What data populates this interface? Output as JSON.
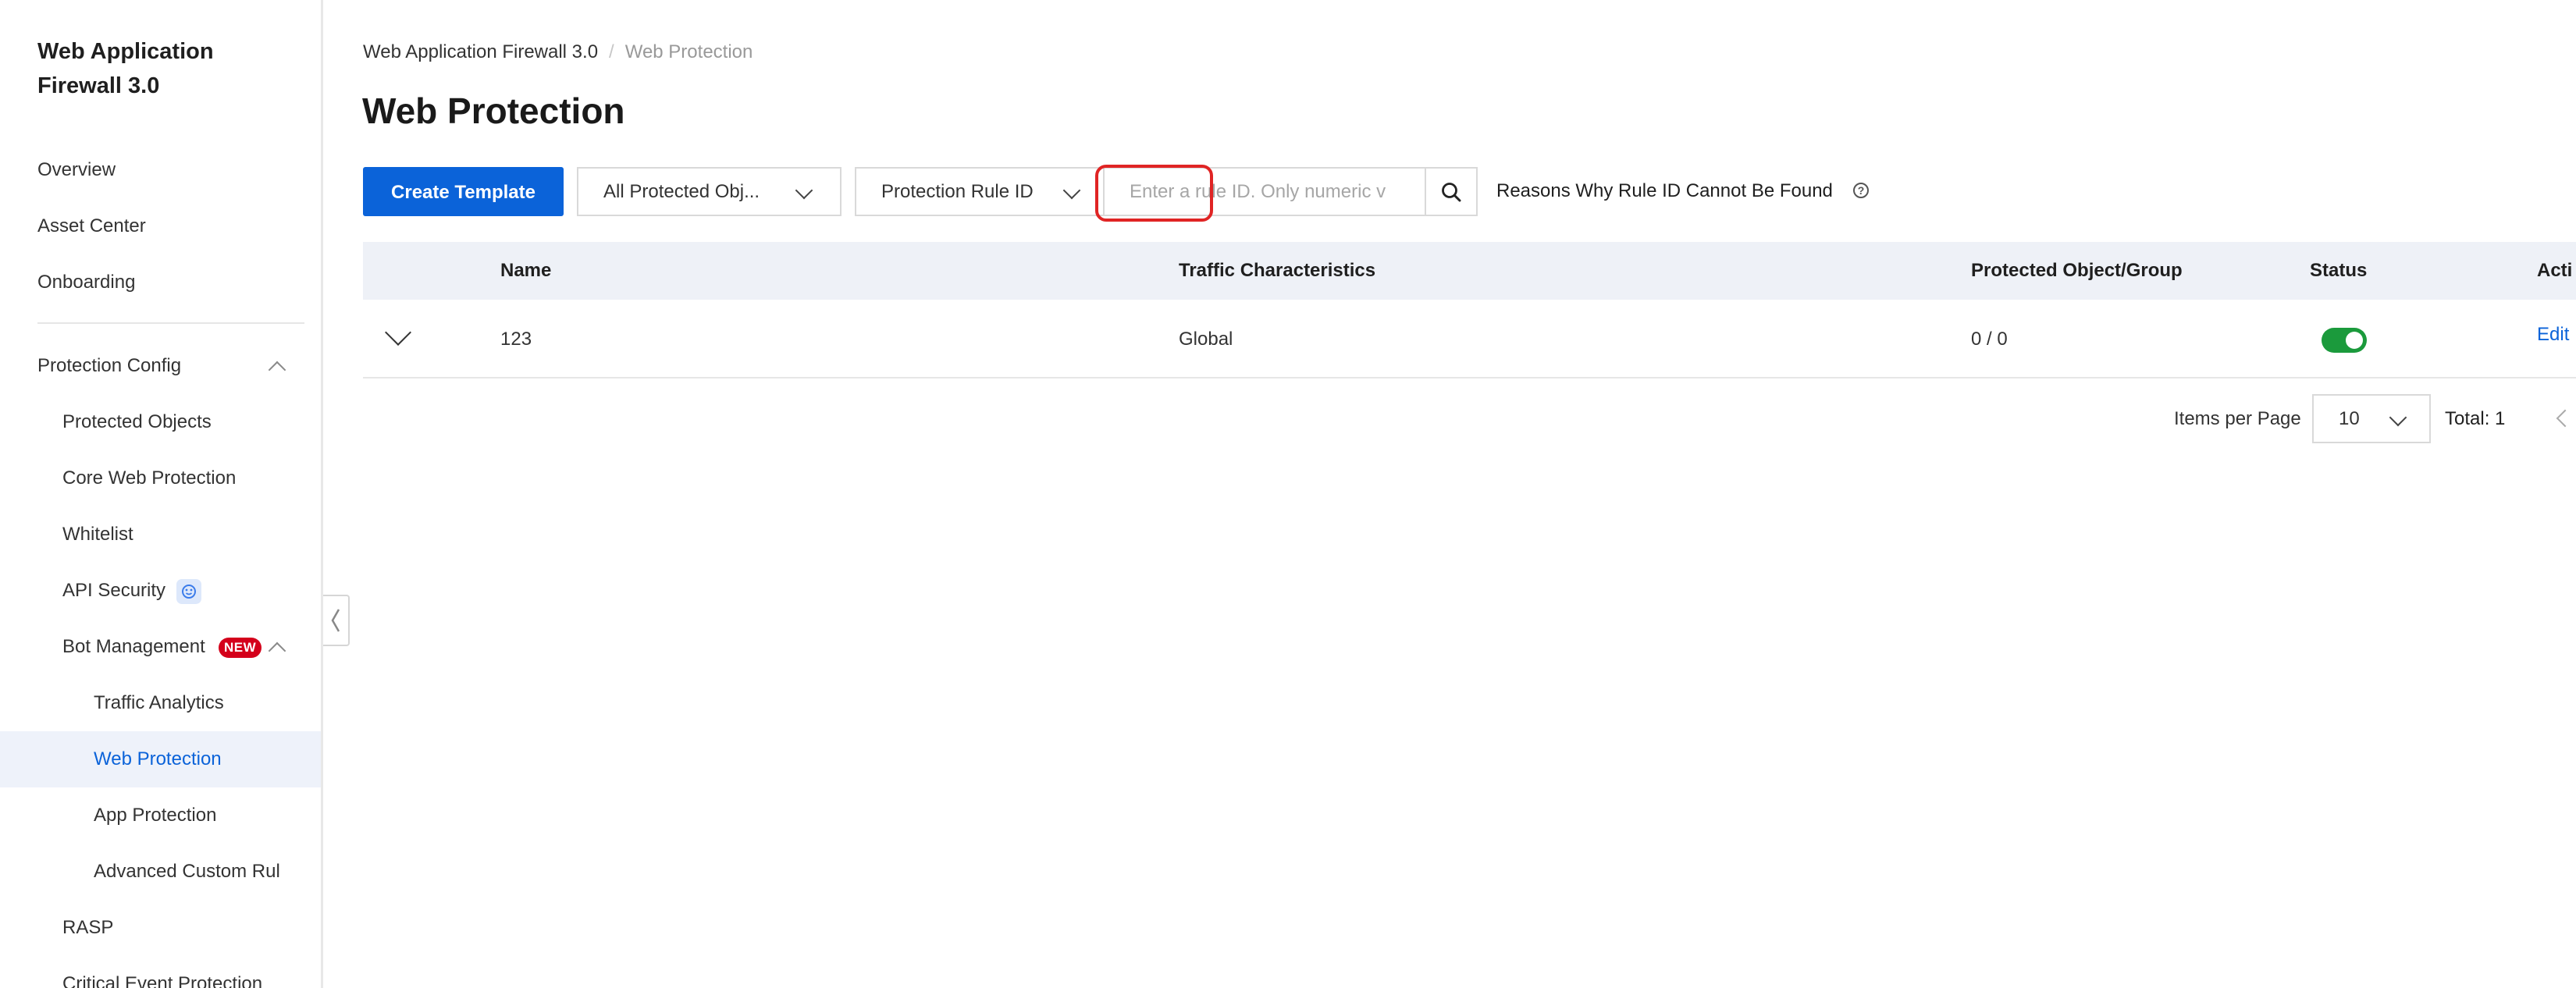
{
  "sidebar": {
    "brand": "Web Application Firewall 3.0",
    "top_items": [
      {
        "label": "Overview"
      },
      {
        "label": "Asset Center"
      },
      {
        "label": "Onboarding"
      }
    ],
    "protection_config": {
      "label": "Protection Config",
      "children": [
        {
          "label": "Protected Objects"
        },
        {
          "label": "Core Web Protection"
        },
        {
          "label": "Whitelist"
        },
        {
          "label": "API Security"
        },
        {
          "label": "Bot Management",
          "badge": "NEW"
        }
      ],
      "bot_children": [
        {
          "label": "Traffic Analytics"
        },
        {
          "label": "Web Protection",
          "active": true
        },
        {
          "label": "App Protection"
        },
        {
          "label": "Advanced Custom Rul"
        }
      ],
      "after": [
        {
          "label": "RASP"
        },
        {
          "label": "Critical Event Protection"
        }
      ]
    }
  },
  "breadcrumb": {
    "root": "Web Application Firewall 3.0",
    "separator": "/",
    "current": "Web Protection"
  },
  "page_title": "Web Protection",
  "toolbar": {
    "create_label": "Create Template",
    "object_filter": "All Protected Obj...",
    "search_field_select": "Protection Rule ID",
    "search_placeholder": "Enter a rule ID. Only numeric v",
    "reasons_link": "Reasons Why Rule ID Cannot Be Found",
    "help_glyph": "?"
  },
  "table": {
    "columns": [
      "Name",
      "Traffic Characteristics",
      "Protected Object/Group",
      "Status",
      "Acti"
    ],
    "rows": [
      {
        "name": "123",
        "traffic": "Global",
        "protected": "0 / 0",
        "status_on": true,
        "action": "Edit"
      }
    ]
  },
  "pagination": {
    "items_per_page_label": "Items per Page",
    "page_size": "10",
    "total": "Total: 1"
  },
  "colors": {
    "primary": "#0b63d9",
    "toggle_on": "#1b9a3c",
    "new_badge": "#d4001b",
    "highlight_box": "#e02424"
  },
  "icons": [
    "chevron-up-icon",
    "api-security-icon",
    "collapse-left-icon",
    "chevron-down-icon",
    "search-icon",
    "help-circle-icon",
    "expand-row-icon",
    "chevron-left-icon"
  ]
}
